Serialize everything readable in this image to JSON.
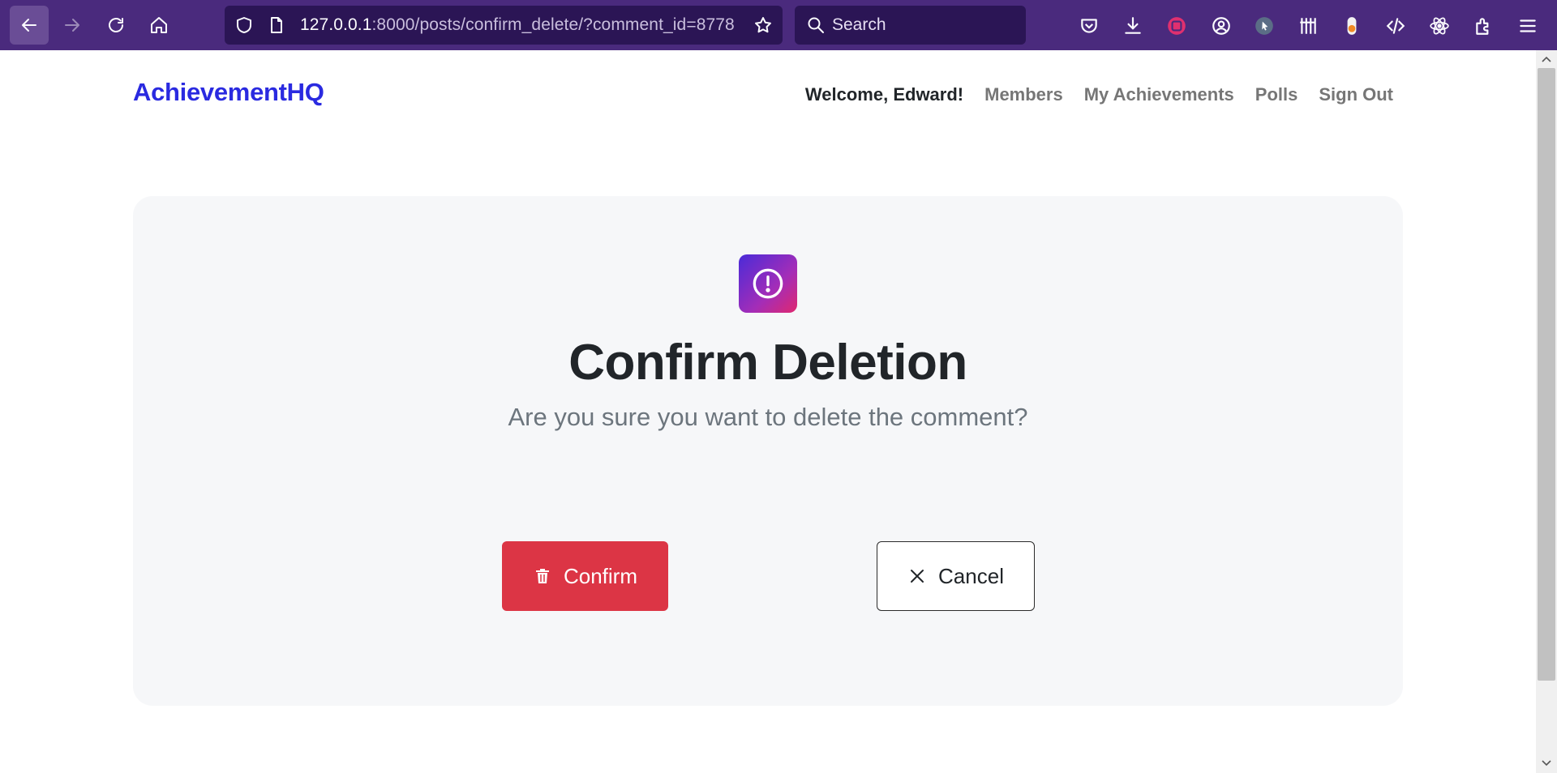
{
  "browser": {
    "url_host": "127.0.0.1",
    "url_path": ":8000/posts/confirm_delete/?comment_id=8778",
    "search_placeholder": "Search"
  },
  "site": {
    "brand": "AchievementHQ",
    "welcome": "Welcome, Edward!",
    "nav": [
      "Members",
      "My Achievements",
      "Polls",
      "Sign Out"
    ]
  },
  "dialog": {
    "title": "Confirm Deletion",
    "message": "Are you sure you want to delete the comment?",
    "confirm_label": "Confirm",
    "cancel_label": "Cancel"
  },
  "colors": {
    "brand": "#2a2ae0",
    "danger": "#dc3545",
    "toolbar": "#4a2a7d"
  }
}
